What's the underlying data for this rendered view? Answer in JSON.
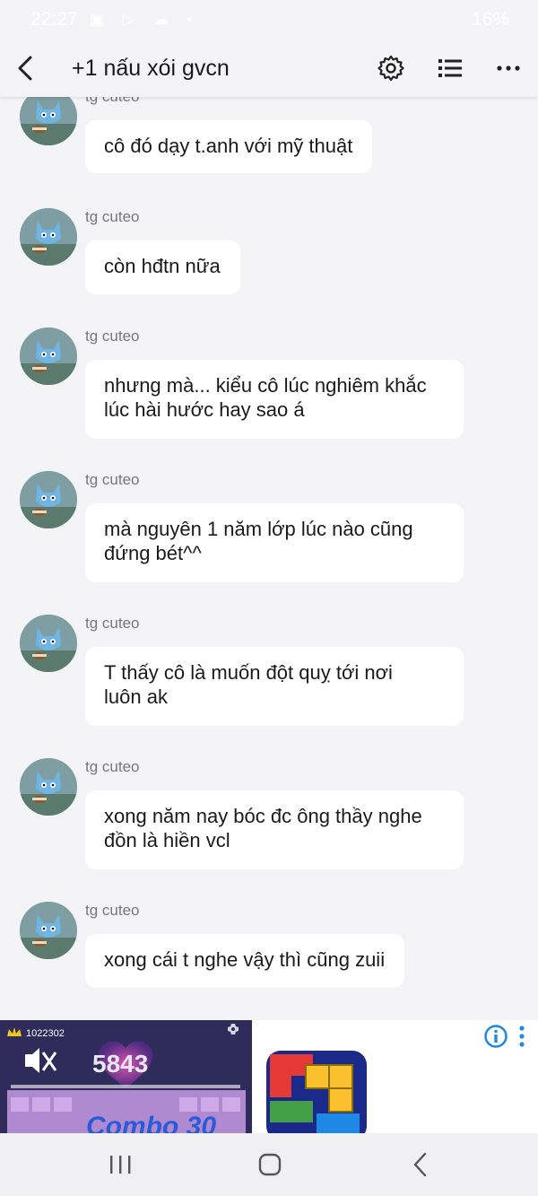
{
  "status_bar": {
    "time": "22:27",
    "left_icons": "▣ ▷ ☁ •",
    "battery": "16%"
  },
  "header": {
    "title": "+1 nấu xói gvcn",
    "icons": [
      "chevron-left-icon",
      "gear-icon",
      "list-icon",
      "more-horizontal-icon"
    ]
  },
  "messages": [
    {
      "sender": "tg cuteo",
      "text": "cô đó dạy t.anh với mỹ thuật"
    },
    {
      "sender": "tg cuteo",
      "text": "còn hđtn nữa"
    },
    {
      "sender": "tg cuteo",
      "text": "nhưng mà... kiểu cô lúc nghiêm khắc\nlúc hài hước hay sao á"
    },
    {
      "sender": "tg cuteo",
      "text": "mà nguyên 1 năm lớp lúc nào cũng\nđứng bét^^"
    },
    {
      "sender": "tg cuteo",
      "text": "T thấy cô là muốn đột quỵ tới nơi\nluôn ak"
    },
    {
      "sender": "tg cuteo",
      "text": "xong năm nay bóc đc ông thầy nghe\nđồn là hiền vcl"
    },
    {
      "sender": "tg cuteo",
      "text": "xong cái t nghe vậy thì cũng zuii"
    }
  ],
  "ad": {
    "best_score": "1022302",
    "score": "5843",
    "combo_text": "Combo 30",
    "info_icon": "info-icon"
  },
  "colors": {
    "background": "#f4f4f6",
    "bubble": "#ffffff",
    "accent": "#1e88e5"
  }
}
